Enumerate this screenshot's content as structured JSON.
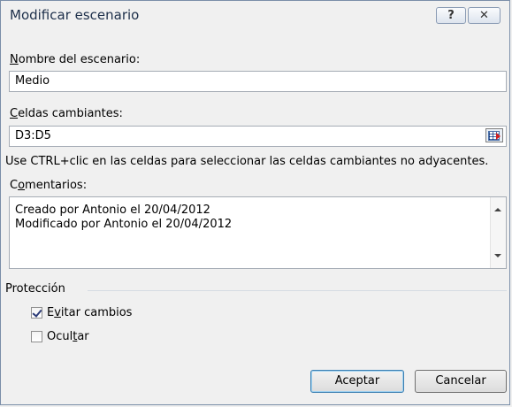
{
  "window": {
    "title": "Modificar escenario",
    "help_glyph": "?",
    "close_glyph": "✕"
  },
  "scenario_name": {
    "label_key": "N",
    "label_rest": "ombre del escenario:",
    "value": "Medio"
  },
  "changing_cells": {
    "label_key": "C",
    "label_rest": "eldas cambiantes:",
    "value": "D3:D5",
    "ref_button_icon": "range-select-icon"
  },
  "hint": "Use CTRL+clic en las celdas para seleccionar las celdas cambiantes no adyacentes.",
  "comments": {
    "label_pre": "C",
    "label_key": "o",
    "label_rest": "mentarios:",
    "lines": [
      "Creado por Antonio el 20/04/2012",
      "Modificado por Antonio el 20/04/2012"
    ]
  },
  "protection": {
    "group_label": "Protección",
    "prevent_changes": {
      "pre": "E",
      "key": "v",
      "rest": "itar cambios",
      "checked": true
    },
    "hide": {
      "pre": "Ocul",
      "key": "t",
      "rest": "ar",
      "checked": false
    }
  },
  "buttons": {
    "ok": "Aceptar",
    "cancel": "Cancelar"
  }
}
